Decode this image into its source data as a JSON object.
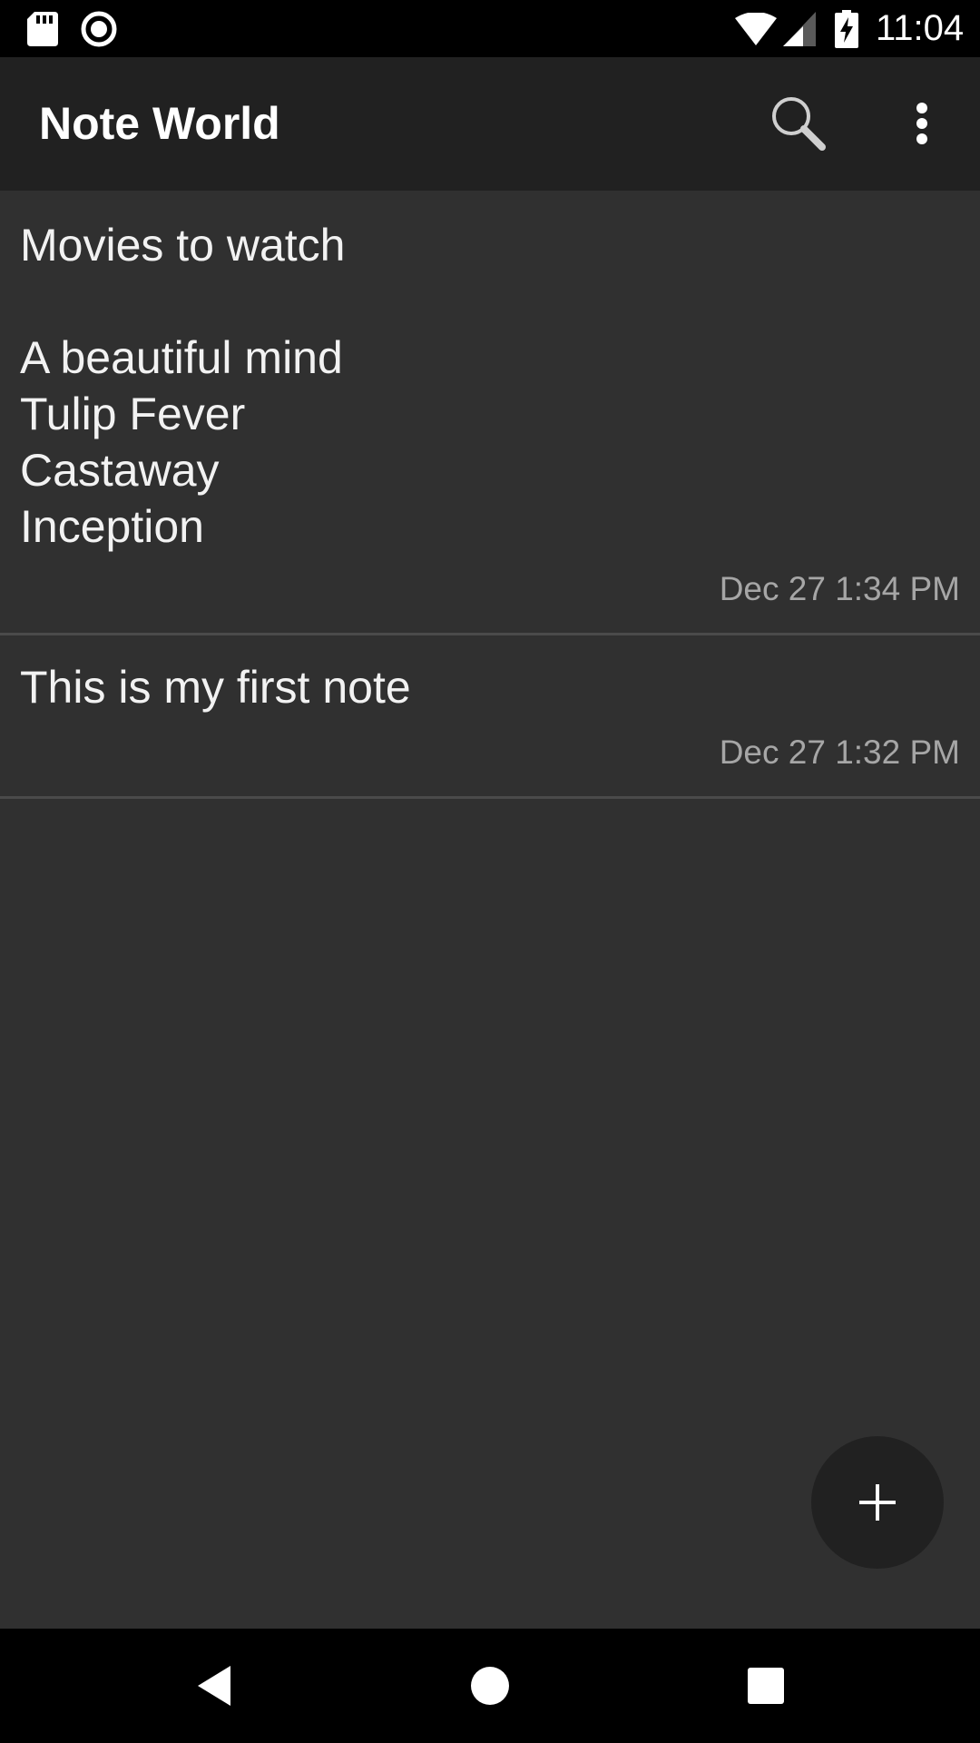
{
  "status_bar": {
    "time": "11:04",
    "left_icons": [
      "sd-card-icon",
      "record-icon"
    ],
    "right_icons": [
      "wifi-icon",
      "cell-signal-icon",
      "battery-charging-icon"
    ]
  },
  "app_bar": {
    "title": "Note World",
    "actions": [
      "search-icon",
      "more-vert-icon"
    ]
  },
  "notes": [
    {
      "text": "Movies to watch\n\nA beautiful mind\nTulip Fever\nCastaway\nInception",
      "date": "Dec 27 1:34 PM"
    },
    {
      "text": "This is my first note",
      "date": "Dec 27 1:32 PM"
    }
  ],
  "fab": {
    "icon": "add-icon"
  },
  "nav_bar": {
    "buttons": [
      "back-icon",
      "home-icon",
      "recents-icon"
    ]
  },
  "colors": {
    "background": "#303030",
    "app_bar": "#212121",
    "status_bar": "#000000",
    "nav_bar": "#000000",
    "divider": "#4a4a4a",
    "date_text": "#a6a6a6"
  }
}
